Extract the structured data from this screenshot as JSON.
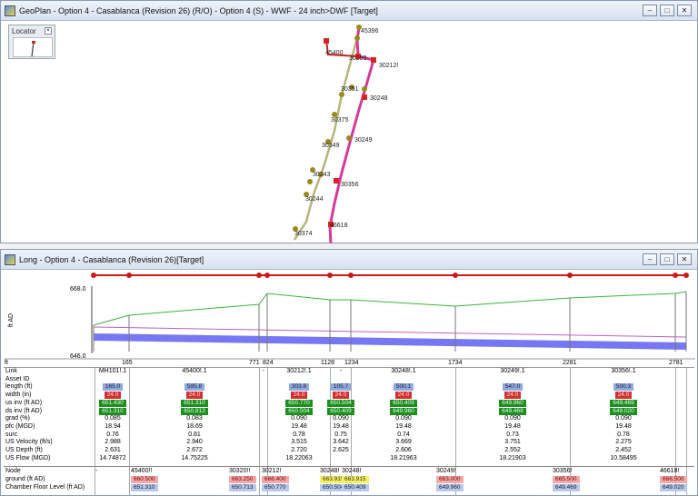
{
  "geoplan": {
    "title": "GeoPlan - Option 4 - Casablanca  (Revision 26) (R/O) - Option 4 (S) - WWF - 24 inch>DWF  [Target]",
    "locator_label": "Locator",
    "labels": [
      "45396",
      "45400",
      "30299",
      "30212!",
      "30351",
      "30248",
      "30375",
      "30249",
      "30349",
      "30243",
      "30356",
      "30244",
      "46618",
      "30374"
    ]
  },
  "longsection": {
    "title": "Long - Option 4 - Casablanca  (Revision 26)[Target]",
    "y_top": "668.0",
    "y_bottom": "646.0",
    "y_axis_label": "ft AD",
    "x_unit": "ft",
    "x_ticks": [
      "165",
      "771",
      "824",
      "1128",
      "1234",
      "1734",
      "2281",
      "2781"
    ]
  },
  "colors": {
    "main": "#cc1a1a",
    "ground": "#3cb43c",
    "pipe": "#4a4af0",
    "link_green": "#8c8c3c"
  },
  "window_buttons": [
    "–",
    "□",
    "✕"
  ],
  "grid": {
    "row_labels": [
      "Link",
      "Asset ID",
      "length (ft)",
      "width (in)",
      "us inv (ft AD)",
      "ds inv (ft AD)",
      "grad (%)",
      "pfc (MGD)",
      "surc",
      "US Velocity (ft/s)",
      "US Depth (ft)",
      "US Flow (MGD)"
    ],
    "links": [
      {
        "id": "MH101!.1",
        "length": "165.0",
        "width": "24.0",
        "us_inv": "651.430",
        "ds_inv": "651.310",
        "grad": "0.085",
        "pfc": "18.94",
        "surc": "0.76",
        "vel": "2.988",
        "depth": "2.631",
        "flow": "14.74872"
      },
      {
        "id": "45400!.1",
        "length": "595.8",
        "width": "24.0",
        "us_inv": "651.310",
        "ds_inv": "650.813",
        "grad": "0.083",
        "pfc": "18.69",
        "surc": "0.81",
        "vel": "2.940",
        "depth": "2.672",
        "flow": "14.75225"
      },
      {
        "id": "-",
        "length": "",
        "width": "",
        "us_inv": "",
        "ds_inv": "",
        "grad": "",
        "pfc": "",
        "surc": "",
        "vel": "",
        "depth": "",
        "flow": ""
      },
      {
        "id": "30212!.1",
        "length": "303.8",
        "width": "24.0",
        "us_inv": "650.770",
        "ds_inv": "650.504",
        "grad": "0.090",
        "pfc": "19.48",
        "surc": "0.78",
        "vel": "3.515",
        "depth": "2.720",
        "flow": "18.22063"
      },
      {
        "id": "-",
        "length": "105.7",
        "width": "24.0",
        "us_inv": "650.504",
        "ds_inv": "650.409",
        "grad": "0.090",
        "pfc": "19.48",
        "surc": "0.75",
        "vel": "3.642",
        "depth": "2.625",
        "flow": ""
      },
      {
        "id": "30248!.1",
        "length": "500.1",
        "width": "24.0",
        "us_inv": "650.409",
        "ds_inv": "649.960",
        "grad": "0.090",
        "pfc": "19.48",
        "surc": "0.74",
        "vel": "3.669",
        "depth": "2.606",
        "flow": "18.21963"
      },
      {
        "id": "30249!.1",
        "length": "547.0",
        "width": "24.0",
        "us_inv": "649.960",
        "ds_inv": "649.469",
        "grad": "0.090",
        "pfc": "19.48",
        "surc": "0.73",
        "vel": "3.751",
        "depth": "2.552",
        "flow": "18.21903"
      },
      {
        "id": "30356!.1",
        "length": "500.3",
        "width": "24.0",
        "us_inv": "649.469",
        "ds_inv": "649.020",
        "grad": "0.090",
        "pfc": "19.48",
        "surc": "0.78",
        "vel": "2.275",
        "depth": "2.452",
        "flow": "10.58495"
      }
    ],
    "node_labels": [
      "Node",
      "ground (ft AD)",
      "Chamber Floor Level (ft AD)"
    ],
    "nodes": [
      {
        "id": "-",
        "ground": "",
        "floor": ""
      },
      {
        "id": "45400!!",
        "ground": "660.500",
        "floor": "651.310"
      },
      {
        "id": "30320!!",
        "ground": "663.250",
        "floor": "650.713"
      },
      {
        "id": "30212!",
        "ground": "666.400",
        "floor": "650.770"
      },
      {
        "id": "30248!",
        "ground": "663.915",
        "floor": "650.504"
      },
      {
        "id": "30248!",
        "ground": "663.915",
        "floor": "650.409"
      },
      {
        "id": "30249!",
        "ground": "663.000",
        "floor": "649.960"
      },
      {
        "id": "30356!",
        "ground": "665.500",
        "floor": "649.469"
      },
      {
        "id": "46618!",
        "ground": "666.500",
        "floor": "649.020"
      }
    ]
  }
}
